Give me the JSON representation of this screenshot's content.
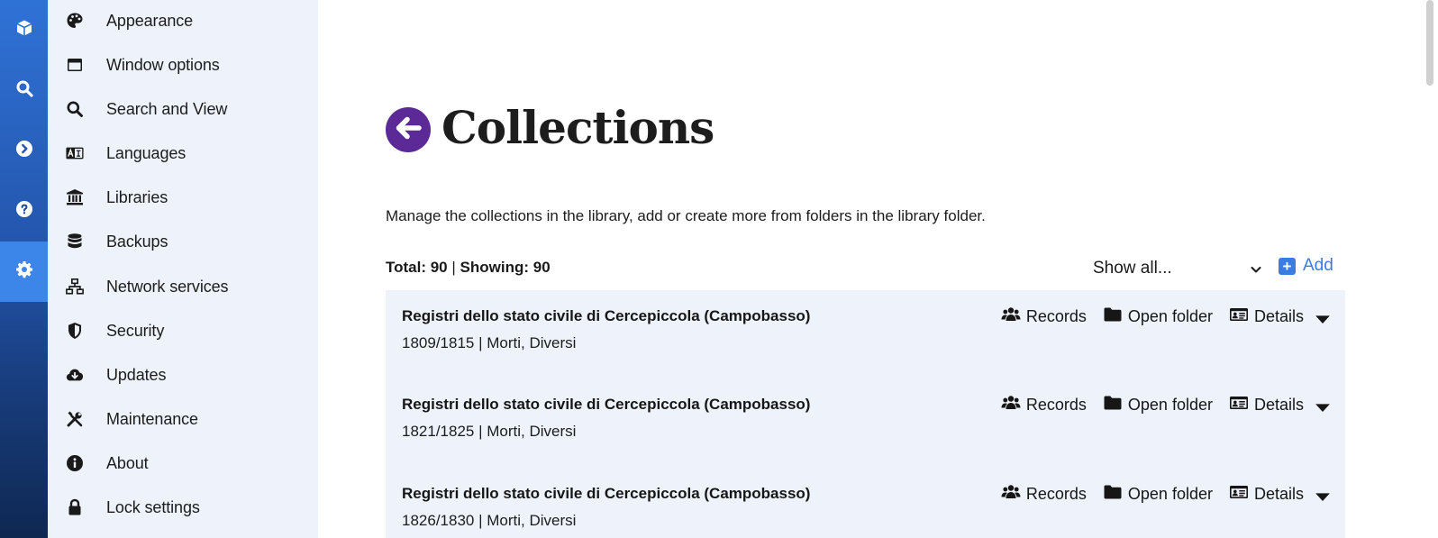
{
  "rail": {
    "items": [
      {
        "icon": "cube-icon"
      },
      {
        "icon": "search-icon"
      },
      {
        "icon": "chevron-right-circle-icon"
      },
      {
        "icon": "help-circle-icon"
      },
      {
        "icon": "gear-icon",
        "active": true
      }
    ]
  },
  "sidebar": {
    "items": [
      {
        "label": "Appearance",
        "icon": "palette-icon"
      },
      {
        "label": "Window options",
        "icon": "window-icon"
      },
      {
        "label": "Search and View",
        "icon": "search-icon"
      },
      {
        "label": "Languages",
        "icon": "language-icon"
      },
      {
        "label": "Libraries",
        "icon": "library-icon"
      },
      {
        "label": "Backups",
        "icon": "database-icon"
      },
      {
        "label": "Network services",
        "icon": "network-icon"
      },
      {
        "label": "Security",
        "icon": "shield-icon"
      },
      {
        "label": "Updates",
        "icon": "cloud-download-icon"
      },
      {
        "label": "Maintenance",
        "icon": "tools-icon"
      },
      {
        "label": "About",
        "icon": "info-icon"
      },
      {
        "label": "Lock settings",
        "icon": "lock-icon"
      }
    ]
  },
  "main": {
    "title": "Collections",
    "description": "Manage the collections in the library, add or create more from folders in the library folder.",
    "totals": {
      "total_label": "Total: 90",
      "separator": "|",
      "showing_label": "Showing: 90"
    },
    "filter": {
      "selected": "Show all..."
    },
    "add_label": "Add",
    "actions": {
      "records": "Records",
      "open_folder": "Open folder",
      "details": "Details"
    },
    "collections": [
      {
        "title": "Registri dello stato civile di Cercepiccola (Campobasso)",
        "subtitle": "1809/1815 | Morti, Diversi"
      },
      {
        "title": "Registri dello stato civile di Cercepiccola (Campobasso)",
        "subtitle": "1821/1825 | Morti, Diversi"
      },
      {
        "title": "Registri dello stato civile di Cercepiccola (Campobasso)",
        "subtitle": "1826/1830 | Morti, Diversi"
      }
    ]
  },
  "colors": {
    "rail_top": "#2f72d6",
    "rail_bottom": "#0f2852",
    "rail_active": "#3b86e8",
    "sidebar_bg": "#eef3fb",
    "back_button": "#5b2a96",
    "accent": "#3a7de0"
  }
}
